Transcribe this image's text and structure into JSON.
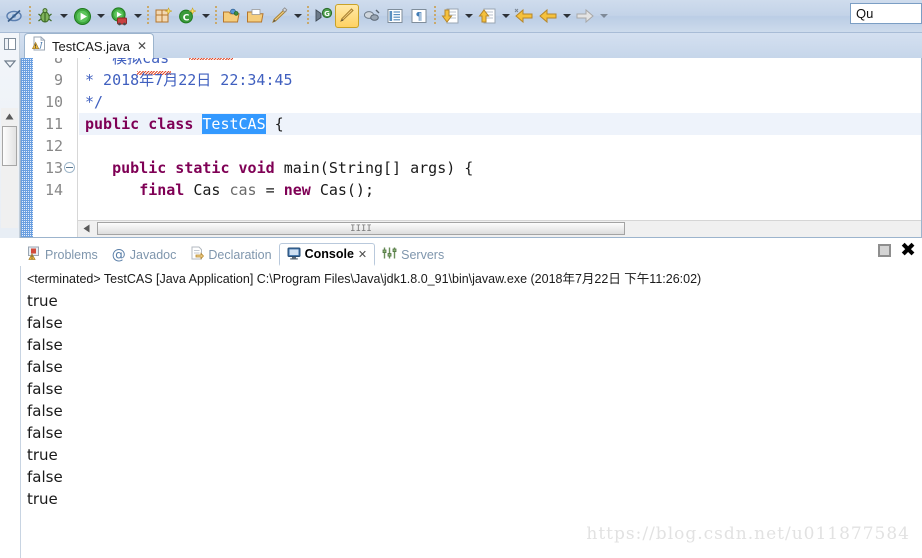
{
  "toolbar": {
    "items": [
      {
        "name": "toggle-mark-occurrences-icon",
        "label": ""
      },
      {
        "name": "debug-icon",
        "label": ""
      },
      {
        "name": "debug-dropdown-arrow",
        "label": ""
      },
      {
        "name": "run-icon",
        "label": ""
      },
      {
        "name": "run-dropdown-arrow",
        "label": ""
      },
      {
        "name": "run-external-tools-icon",
        "label": ""
      },
      {
        "name": "external-tools-dropdown-arrow",
        "label": ""
      },
      {
        "name": "new-java-package-icon",
        "label": ""
      },
      {
        "name": "new-java-class-icon",
        "label": ""
      },
      {
        "name": "new-class-dropdown-arrow",
        "label": ""
      },
      {
        "name": "open-type-icon",
        "label": ""
      },
      {
        "name": "open-task-icon",
        "label": ""
      },
      {
        "name": "edit-icon",
        "label": ""
      },
      {
        "name": "edit-dropdown-arrow",
        "label": ""
      },
      {
        "name": "search-icon",
        "label": ""
      },
      {
        "name": "highlight-pen-icon",
        "label": ""
      },
      {
        "name": "link-icon",
        "label": ""
      },
      {
        "name": "show-whitespace-icon",
        "label": ""
      },
      {
        "name": "paragraph-marks-icon",
        "label": ""
      },
      {
        "name": "next-annotation-icon",
        "label": ""
      },
      {
        "name": "next-annotation-arrow",
        "label": ""
      },
      {
        "name": "previous-annotation-icon",
        "label": ""
      },
      {
        "name": "previous-annotation-arrow",
        "label": ""
      },
      {
        "name": "back-icon",
        "label": ""
      },
      {
        "name": "back-dropdown-arrow",
        "label": ""
      },
      {
        "name": "forward-icon",
        "label": ""
      },
      {
        "name": "forward-dropdown-arrow",
        "label": ""
      }
    ]
  },
  "quick_access": {
    "value": "Qu",
    "placeholder": "Quick Access"
  },
  "editor": {
    "tab": {
      "label": "TestCAS.java",
      "close": "✕",
      "icon": "java-file-warning-icon"
    },
    "lines": [
      {
        "number": "8",
        "fold": false
      },
      {
        "number": "9",
        "fold": false
      },
      {
        "number": "10",
        "fold": false
      },
      {
        "number": "11",
        "fold": false
      },
      {
        "number": "12",
        "fold": false
      },
      {
        "number": "13",
        "fold": true
      },
      {
        "number": "14",
        "fold": false
      }
    ],
    "code": {
      "line8_comment": "*  模拟cas",
      "line9_comment": "* 2018年7月22日 22:34:45",
      "line10_comment": "*/",
      "line11_kw1": "public class ",
      "line11_sel": "TestCAS",
      "line11_tail": " {",
      "line12": "",
      "line13_kw": "public static void ",
      "line13_rest": "main(String[] args) {",
      "line14_final": "final ",
      "line14_type": "Cas ",
      "line14_var": "cas ",
      "line14_eq": "= ",
      "line14_new": "new ",
      "line14_ctor": "Cas();"
    },
    "scrollbar_grip": "IIII"
  },
  "console": {
    "tabs": [
      {
        "label": "Problems",
        "icon": "problems-icon",
        "active": false
      },
      {
        "label": "Javadoc",
        "icon": "javadoc-at-icon",
        "active": false
      },
      {
        "label": "Declaration",
        "icon": "declaration-icon",
        "active": false
      },
      {
        "label": "Console",
        "icon": "console-monitor-icon",
        "active": true,
        "close": "✕"
      },
      {
        "label": "Servers",
        "icon": "servers-icon",
        "active": false
      }
    ],
    "tools": [
      {
        "name": "minimize-restore-button"
      },
      {
        "name": "close-panel-button",
        "label": "✖"
      }
    ],
    "terminated_line": "<terminated> TestCAS [Java Application] C:\\Program Files\\Java\\jdk1.8.0_91\\bin\\javaw.exe (2018年7月22日 下午11:26:02)",
    "output": [
      "true",
      "false",
      "false",
      "false",
      "false",
      "false",
      "false",
      "true",
      "false",
      "true"
    ]
  },
  "watermark": "https://blog.csdn.net/u011877584",
  "colors": {
    "toolbar_bg": "#c3d3e8",
    "selection_blue": "#3399ff",
    "keyword_purple": "#7f0055",
    "comment_blue": "#3f5fbf",
    "ruler_blue": "#6a9fe0"
  }
}
